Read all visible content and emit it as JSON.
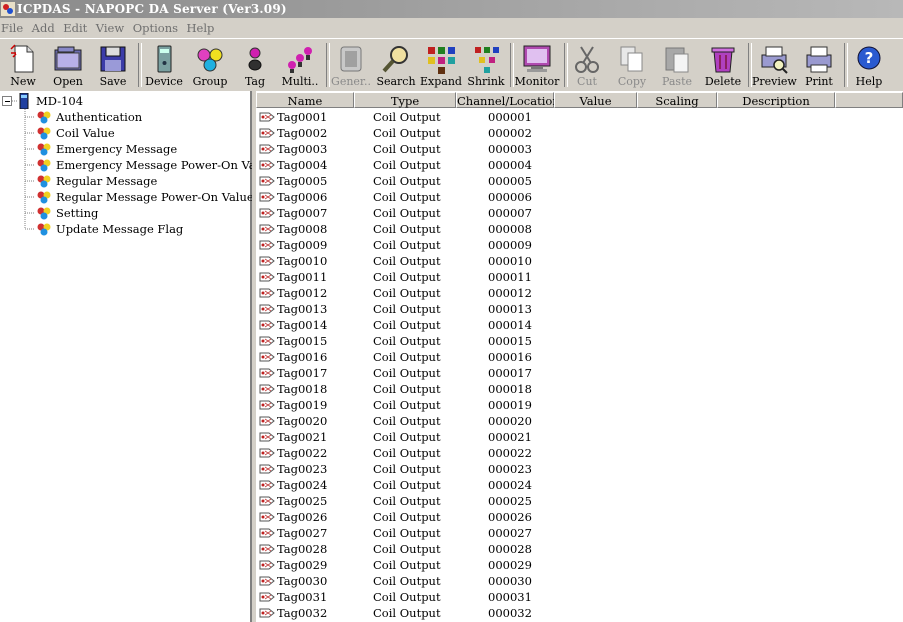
{
  "window": {
    "title": "ICPDAS - NAPOPC DA Server (Ver3.09)"
  },
  "menu": [
    {
      "label": "File"
    },
    {
      "label": "Add"
    },
    {
      "label": "Edit"
    },
    {
      "label": "View"
    },
    {
      "label": "Options"
    },
    {
      "label": "Help"
    }
  ],
  "toolbar": {
    "new": "New",
    "open": "Open",
    "save": "Save",
    "device": "Device",
    "group": "Group",
    "tag": "Tag",
    "multi": "Multi..",
    "generate": "Gener..",
    "search": "Search",
    "expand": "Expand",
    "shrink": "Shrink",
    "monitor": "Monitor",
    "cut": "Cut",
    "copy": "Copy",
    "paste": "Paste",
    "delete": "Delete",
    "preview": "Preview",
    "print": "Print",
    "help": "Help"
  },
  "tree": {
    "root": "MD-104",
    "groups": [
      {
        "label": "Authentication"
      },
      {
        "label": "Coil Value"
      },
      {
        "label": "Emergency Message"
      },
      {
        "label": "Emergency Message Power-On Value"
      },
      {
        "label": "Regular Message"
      },
      {
        "label": "Regular Message Power-On Value"
      },
      {
        "label": "Setting"
      },
      {
        "label": "Update Message Flag"
      }
    ]
  },
  "list": {
    "columns": [
      {
        "label": "Name"
      },
      {
        "label": "Type"
      },
      {
        "label": "Channel/Location"
      },
      {
        "label": "Value"
      },
      {
        "label": "Scaling"
      },
      {
        "label": "Description"
      }
    ],
    "rows": [
      {
        "name": "Tag0001",
        "type": "Coil Output",
        "channel": "000001"
      },
      {
        "name": "Tag0002",
        "type": "Coil Output",
        "channel": "000002"
      },
      {
        "name": "Tag0003",
        "type": "Coil Output",
        "channel": "000003"
      },
      {
        "name": "Tag0004",
        "type": "Coil Output",
        "channel": "000004"
      },
      {
        "name": "Tag0005",
        "type": "Coil Output",
        "channel": "000005"
      },
      {
        "name": "Tag0006",
        "type": "Coil Output",
        "channel": "000006"
      },
      {
        "name": "Tag0007",
        "type": "Coil Output",
        "channel": "000007"
      },
      {
        "name": "Tag0008",
        "type": "Coil Output",
        "channel": "000008"
      },
      {
        "name": "Tag0009",
        "type": "Coil Output",
        "channel": "000009"
      },
      {
        "name": "Tag0010",
        "type": "Coil Output",
        "channel": "000010"
      },
      {
        "name": "Tag0011",
        "type": "Coil Output",
        "channel": "000011"
      },
      {
        "name": "Tag0012",
        "type": "Coil Output",
        "channel": "000012"
      },
      {
        "name": "Tag0013",
        "type": "Coil Output",
        "channel": "000013"
      },
      {
        "name": "Tag0014",
        "type": "Coil Output",
        "channel": "000014"
      },
      {
        "name": "Tag0015",
        "type": "Coil Output",
        "channel": "000015"
      },
      {
        "name": "Tag0016",
        "type": "Coil Output",
        "channel": "000016"
      },
      {
        "name": "Tag0017",
        "type": "Coil Output",
        "channel": "000017"
      },
      {
        "name": "Tag0018",
        "type": "Coil Output",
        "channel": "000018"
      },
      {
        "name": "Tag0019",
        "type": "Coil Output",
        "channel": "000019"
      },
      {
        "name": "Tag0020",
        "type": "Coil Output",
        "channel": "000020"
      },
      {
        "name": "Tag0021",
        "type": "Coil Output",
        "channel": "000021"
      },
      {
        "name": "Tag0022",
        "type": "Coil Output",
        "channel": "000022"
      },
      {
        "name": "Tag0023",
        "type": "Coil Output",
        "channel": "000023"
      },
      {
        "name": "Tag0024",
        "type": "Coil Output",
        "channel": "000024"
      },
      {
        "name": "Tag0025",
        "type": "Coil Output",
        "channel": "000025"
      },
      {
        "name": "Tag0026",
        "type": "Coil Output",
        "channel": "000026"
      },
      {
        "name": "Tag0027",
        "type": "Coil Output",
        "channel": "000027"
      },
      {
        "name": "Tag0028",
        "type": "Coil Output",
        "channel": "000028"
      },
      {
        "name": "Tag0029",
        "type": "Coil Output",
        "channel": "000029"
      },
      {
        "name": "Tag0030",
        "type": "Coil Output",
        "channel": "000030"
      },
      {
        "name": "Tag0031",
        "type": "Coil Output",
        "channel": "000031"
      },
      {
        "name": "Tag0032",
        "type": "Coil Output",
        "channel": "000032"
      }
    ]
  }
}
